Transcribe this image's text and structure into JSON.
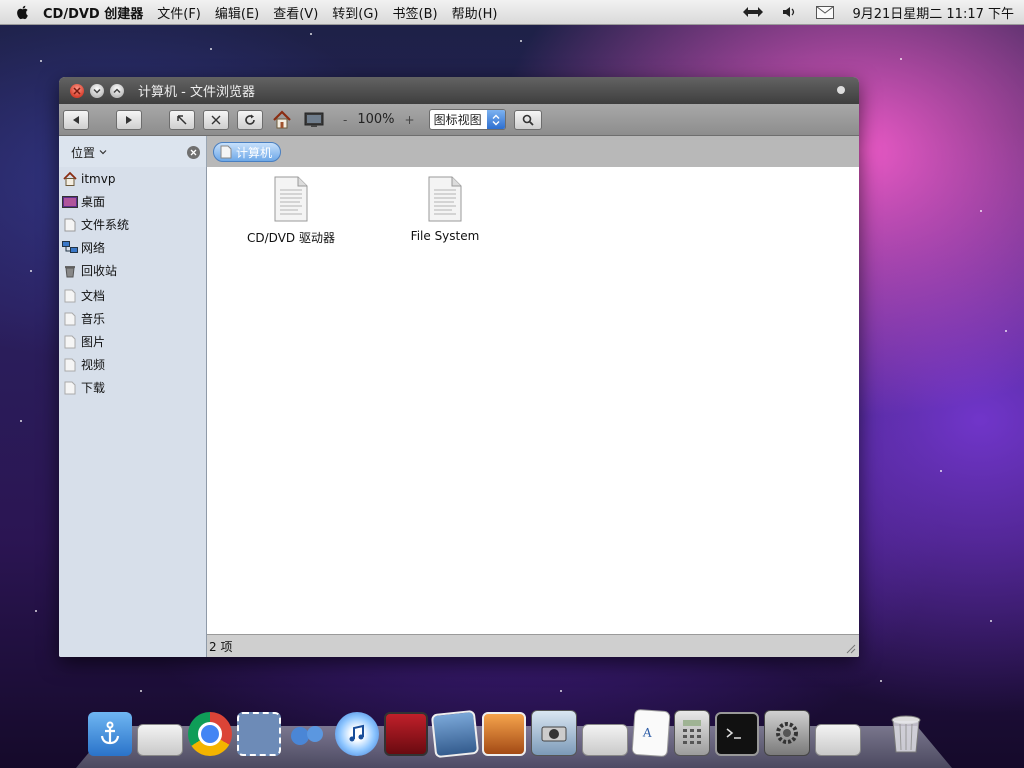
{
  "menubar": {
    "app_name": "CD/DVD 创建器",
    "menus": [
      "文件(F)",
      "编辑(E)",
      "查看(V)",
      "转到(G)",
      "书签(B)",
      "帮助(H)"
    ],
    "tray_icons": [
      "network-icon",
      "volume-icon",
      "mail-icon"
    ],
    "clock": "9月21日星期二 11:17 下午"
  },
  "window": {
    "title": "计算机 - 文件浏览器",
    "toolbar": {
      "zoom_level": "100%",
      "zoom_minus": "-",
      "zoom_plus": "+",
      "view_mode": "图标视图"
    },
    "location": {
      "places_label": "位置",
      "path_button": "计算机"
    },
    "sidebar": {
      "items": [
        {
          "label": "itmvp",
          "icon": "home-icon"
        },
        {
          "label": "桌面",
          "icon": "desktop-icon"
        },
        {
          "label": "文件系统",
          "icon": "drive-icon"
        },
        {
          "label": "网络",
          "icon": "network-icon"
        },
        {
          "label": "回收站",
          "icon": "trash-icon"
        },
        {
          "label": "文档",
          "icon": "folder-icon"
        },
        {
          "label": "音乐",
          "icon": "folder-icon"
        },
        {
          "label": "图片",
          "icon": "folder-icon"
        },
        {
          "label": "视频",
          "icon": "folder-icon"
        },
        {
          "label": "下载",
          "icon": "folder-icon"
        }
      ]
    },
    "files": [
      {
        "label": "CD/DVD 驱动器",
        "icon": "document-icon"
      },
      {
        "label": "File System",
        "icon": "document-icon"
      }
    ],
    "status": "2 项"
  },
  "dock": {
    "items": [
      "finder-icon",
      "window-icon",
      "chrome-icon",
      "mail-stamp-icon",
      "messenger-icon",
      "itunes-icon",
      "photo-booth-icon",
      "iphoto-icon",
      "image-capture-icon",
      "camera-icon",
      "window-icon",
      "textedit-icon",
      "calculator-icon",
      "terminal-icon",
      "system-preferences-icon",
      "window-icon",
      "trash-icon"
    ]
  },
  "colors": {
    "accent": "#3b7fd6",
    "sidebar_bg": "#d7dfea",
    "window_title_bg": "#4a4a4a"
  }
}
